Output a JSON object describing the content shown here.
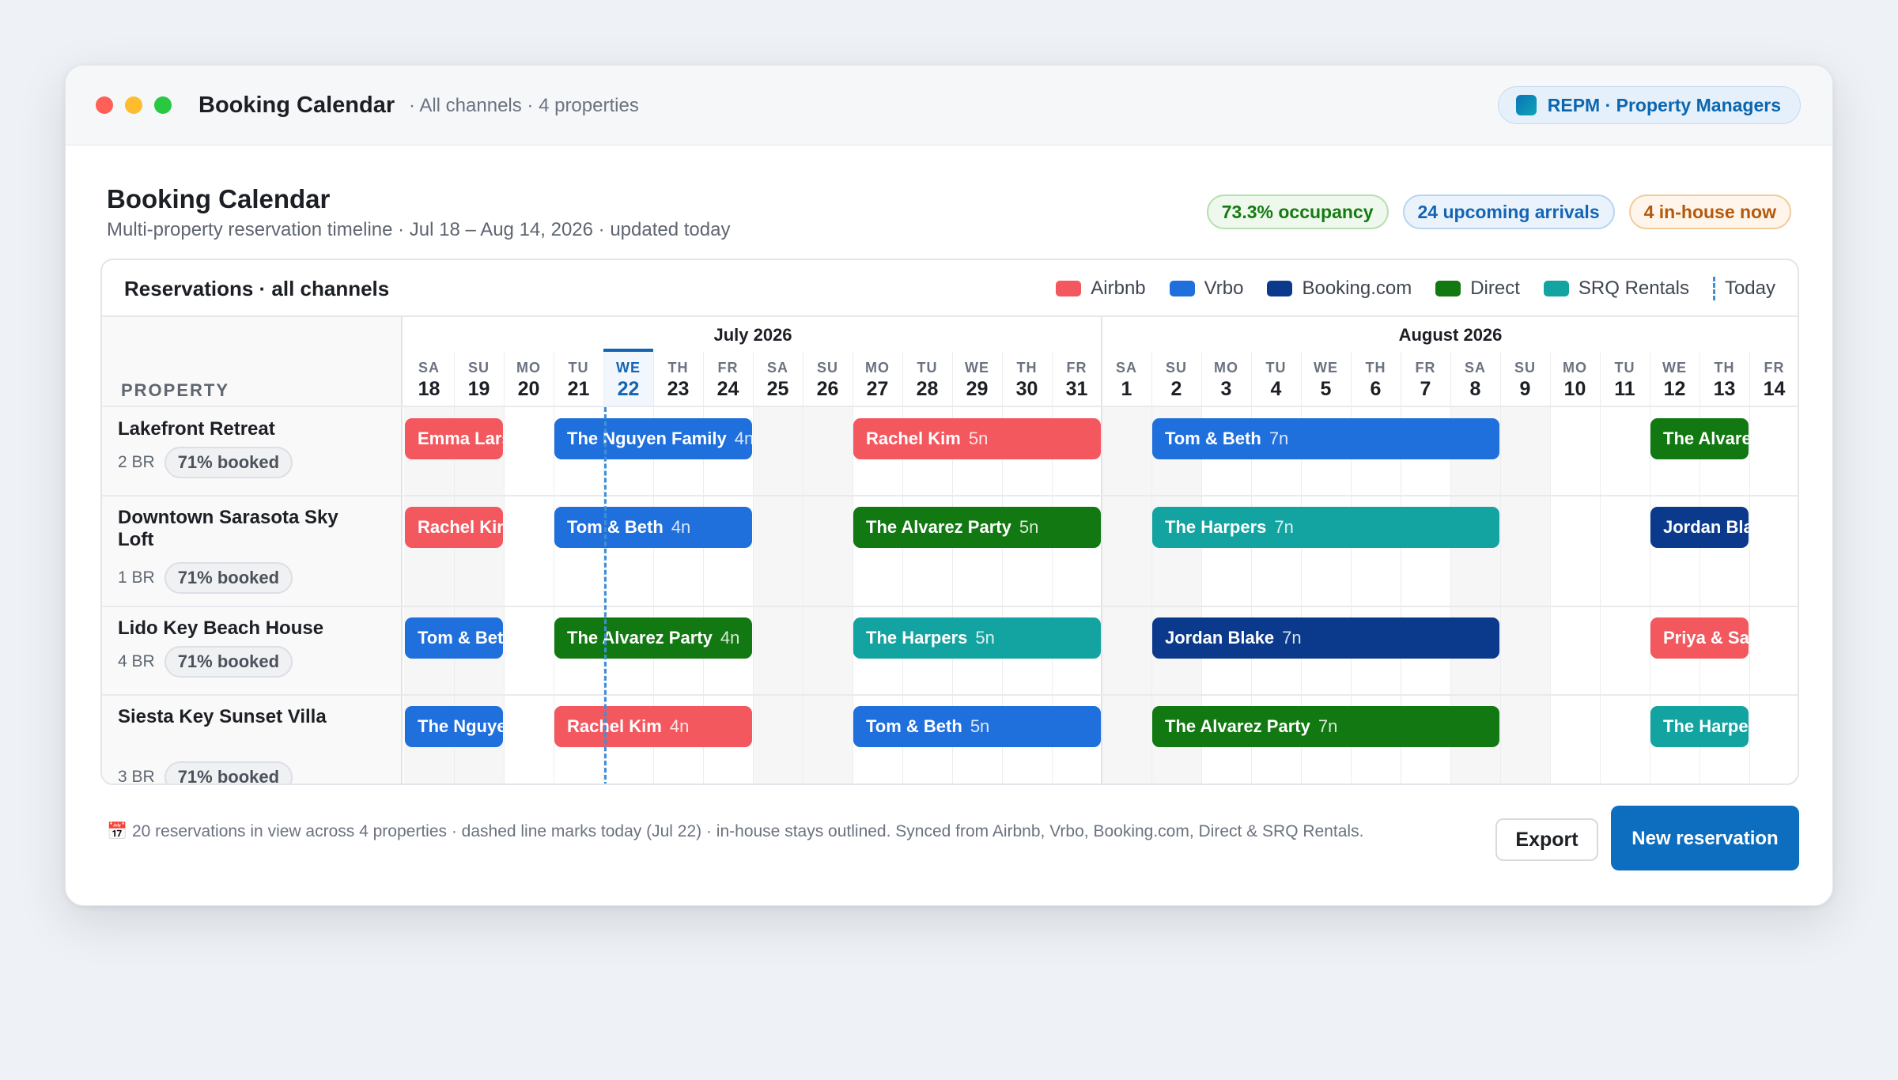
{
  "window": {
    "title": "Booking Calendar",
    "subtitle": "· All channels · 4 properties",
    "brand": "REPM · Property Managers"
  },
  "page": {
    "title": "Booking Calendar",
    "subtitle": "Multi-property reservation timeline · Jul 18 – Aug 14, 2026 · updated today"
  },
  "stats": {
    "occupancy": "73.3% occupancy",
    "arrivals": "24 upcoming arrivals",
    "inhouse": "4 in-house now"
  },
  "calendar": {
    "card_title": "Reservations · all channels",
    "property_header": "PROPERTY",
    "legend": [
      {
        "label": "Airbnb",
        "color": "#f4585f"
      },
      {
        "label": "Vrbo",
        "color": "#1f6fdc"
      },
      {
        "label": "Booking.com",
        "color": "#0b3a8c"
      },
      {
        "label": "Direct",
        "color": "#127812"
      },
      {
        "label": "SRQ Rentals",
        "color": "#13a3a0"
      }
    ],
    "legend_today": "Today",
    "months": [
      {
        "label": "July 2026",
        "start_index": 0,
        "days": 14
      },
      {
        "label": "August 2026",
        "start_index": 14,
        "days": 14
      }
    ],
    "days": [
      {
        "dow": "SA",
        "num": "18"
      },
      {
        "dow": "SU",
        "num": "19"
      },
      {
        "dow": "MO",
        "num": "20"
      },
      {
        "dow": "TU",
        "num": "21"
      },
      {
        "dow": "WE",
        "num": "22"
      },
      {
        "dow": "TH",
        "num": "23"
      },
      {
        "dow": "FR",
        "num": "24"
      },
      {
        "dow": "SA",
        "num": "25"
      },
      {
        "dow": "SU",
        "num": "26"
      },
      {
        "dow": "MO",
        "num": "27"
      },
      {
        "dow": "TU",
        "num": "28"
      },
      {
        "dow": "WE",
        "num": "29"
      },
      {
        "dow": "TH",
        "num": "30"
      },
      {
        "dow": "FR",
        "num": "31"
      },
      {
        "dow": "SA",
        "num": "1"
      },
      {
        "dow": "SU",
        "num": "2"
      },
      {
        "dow": "MO",
        "num": "3"
      },
      {
        "dow": "TU",
        "num": "4"
      },
      {
        "dow": "WE",
        "num": "5"
      },
      {
        "dow": "TH",
        "num": "6"
      },
      {
        "dow": "FR",
        "num": "7"
      },
      {
        "dow": "SA",
        "num": "8"
      },
      {
        "dow": "SU",
        "num": "9"
      },
      {
        "dow": "MO",
        "num": "10"
      },
      {
        "dow": "TU",
        "num": "11"
      },
      {
        "dow": "WE",
        "num": "12"
      },
      {
        "dow": "TH",
        "num": "13"
      },
      {
        "dow": "FR",
        "num": "14"
      }
    ],
    "today_index": 4,
    "properties": [
      {
        "name": "Lakefront Retreat",
        "br": "2 BR",
        "booked": "71% booked",
        "reservations": [
          {
            "guest": "Emma Larson",
            "nights": "",
            "channel": "Airbnb",
            "start": 0,
            "length": 2
          },
          {
            "guest": "The Nguyen Family",
            "nights": "4n",
            "channel": "Vrbo",
            "start": 3,
            "length": 4
          },
          {
            "guest": "Rachel Kim",
            "nights": "5n",
            "channel": "Airbnb",
            "start": 9,
            "length": 5
          },
          {
            "guest": "Tom & Beth",
            "nights": "7n",
            "channel": "Vrbo",
            "start": 15,
            "length": 7
          },
          {
            "guest": "The Alvarez Party",
            "nights": "",
            "channel": "Direct",
            "start": 25,
            "length": 2
          }
        ]
      },
      {
        "name": "Downtown Sarasota Sky Loft",
        "br": "1 BR",
        "booked": "71% booked",
        "reservations": [
          {
            "guest": "Rachel Kim",
            "nights": "",
            "channel": "Airbnb",
            "start": 0,
            "length": 2
          },
          {
            "guest": "Tom & Beth",
            "nights": "4n",
            "channel": "Vrbo",
            "start": 3,
            "length": 4
          },
          {
            "guest": "The Alvarez Party",
            "nights": "5n",
            "channel": "Direct",
            "start": 9,
            "length": 5
          },
          {
            "guest": "The Harpers",
            "nights": "7n",
            "channel": "SRQ Rentals",
            "start": 15,
            "length": 7
          },
          {
            "guest": "Jordan Blake",
            "nights": "",
            "channel": "Booking.com",
            "start": 25,
            "length": 2
          }
        ]
      },
      {
        "name": "Lido Key Beach House",
        "br": "4 BR",
        "booked": "71% booked",
        "reservations": [
          {
            "guest": "Tom & Beth",
            "nights": "",
            "channel": "Vrbo",
            "start": 0,
            "length": 2
          },
          {
            "guest": "The Alvarez Party",
            "nights": "4n",
            "channel": "Direct",
            "start": 3,
            "length": 4
          },
          {
            "guest": "The Harpers",
            "nights": "5n",
            "channel": "SRQ Rentals",
            "start": 9,
            "length": 5
          },
          {
            "guest": "Jordan Blake",
            "nights": "7n",
            "channel": "Booking.com",
            "start": 15,
            "length": 7
          },
          {
            "guest": "Priya & Sam",
            "nights": "",
            "channel": "Airbnb",
            "start": 25,
            "length": 2
          }
        ]
      },
      {
        "name": "Siesta Key Sunset Villa",
        "br": "3 BR",
        "booked": "71% booked",
        "reservations": [
          {
            "guest": "The Nguyen Family",
            "nights": "",
            "channel": "Vrbo",
            "start": 0,
            "length": 2
          },
          {
            "guest": "Rachel Kim",
            "nights": "4n",
            "channel": "Airbnb",
            "start": 3,
            "length": 4
          },
          {
            "guest": "Tom & Beth",
            "nights": "5n",
            "channel": "Vrbo",
            "start": 9,
            "length": 5
          },
          {
            "guest": "The Alvarez Party",
            "nights": "7n",
            "channel": "Direct",
            "start": 15,
            "length": 7
          },
          {
            "guest": "The Harpers",
            "nights": "",
            "channel": "SRQ Rentals",
            "start": 25,
            "length": 2
          }
        ]
      }
    ]
  },
  "footer": {
    "note": "📅 20 reservations in view across 4 properties · dashed line marks today (Jul 22) · in-house stays outlined. Synced from Airbnb, Vrbo, Booking.com, Direct & SRQ Rentals.",
    "export_label": "Export",
    "new_label": "New reservation"
  }
}
